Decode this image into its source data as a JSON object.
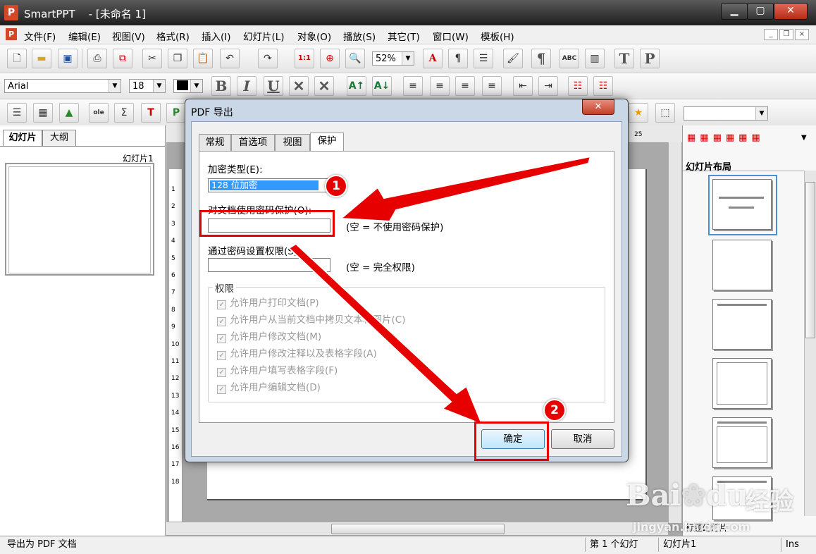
{
  "window": {
    "app_name": "SmartPPT",
    "doc_title": "- [未命名 1]",
    "logo_letter": "P",
    "minimize": "▁",
    "maximize": "▢",
    "close": "✕"
  },
  "menu": {
    "items": [
      "文件(F)",
      "编辑(E)",
      "视图(V)",
      "格式(R)",
      "插入(I)",
      "幻灯片(L)",
      "对象(O)",
      "播放(S)",
      "其它(T)",
      "窗口(W)",
      "模板(H)"
    ],
    "mdi_minimize": "_",
    "mdi_restore": "❐",
    "mdi_close": "×"
  },
  "toolbar1": {
    "zoom_value": "52%",
    "ratio_label": "1:1"
  },
  "toolbar2": {
    "font_name": "Arial",
    "font_size": "18",
    "bold": "B",
    "italic": "I",
    "underline": "U"
  },
  "left_panel": {
    "tab_slides": "幻灯片",
    "tab_outline": "大纲",
    "slide_label": "幻灯片1"
  },
  "ruler": {
    "numbers": [
      "1",
      "2",
      "3",
      "4",
      "5",
      "6",
      "7",
      "8",
      "9",
      "10",
      "11",
      "12",
      "13",
      "14",
      "15",
      "16",
      "17",
      "18"
    ],
    "top_number": "25"
  },
  "right_panel": {
    "title": "幻灯片布局",
    "bottom_label": "标题幻灯片"
  },
  "status": {
    "message": "导出为 PDF 文档",
    "slide_counter": "第 1 个幻灯",
    "slide_name": "幻灯片1",
    "mode": "Ins"
  },
  "dialog": {
    "title": "PDF 导出",
    "close": "✕",
    "tabs": [
      "常规",
      "首选项",
      "视图",
      "保护"
    ],
    "encryption_label": "加密类型(E):",
    "encryption_value": "128 位加密",
    "open_password_label": "对文档使用密码保护(O):",
    "open_password_hint": "(空 = 不使用密码保护)",
    "perm_password_label": "通过密码设置权限(S):",
    "perm_password_hint": "(空 = 完全权限)",
    "permissions_title": "权限",
    "permissions": [
      "允许用户打印文档(P)",
      "允许用户从当前文档中拷贝文本和图片(C)",
      "允许用户修改文档(M)",
      "允许用户修改注释以及表格字段(A)",
      "允许用户填写表格字段(F)",
      "允许用户编辑文档(D)"
    ],
    "ok": "确定",
    "cancel": "取消"
  },
  "annotations": {
    "badge1": "1",
    "badge2": "2",
    "color": "#e60000"
  },
  "watermark": {
    "brand": "Bai",
    "brand2": "du",
    "chinese": "经验",
    "url": "jingyan.baidu.com"
  }
}
